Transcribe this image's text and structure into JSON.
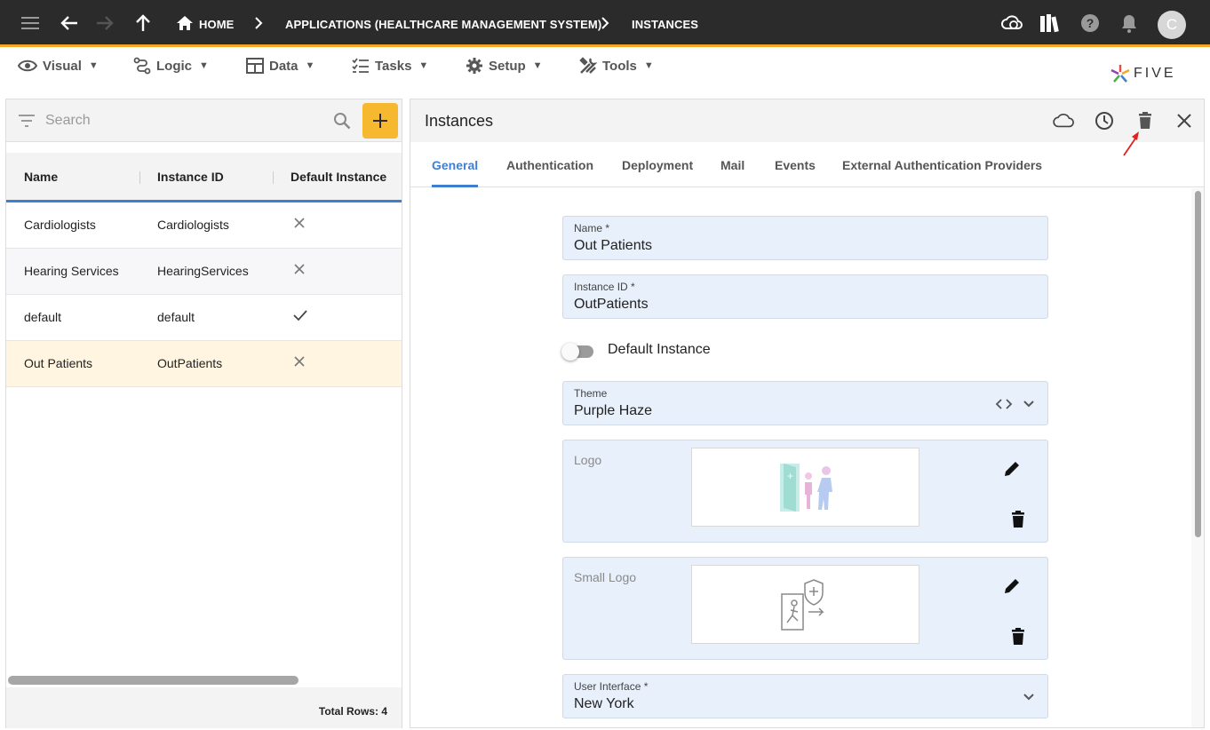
{
  "appbar": {
    "breadcrumbs": [
      {
        "label": "HOME"
      },
      {
        "label": "APPLICATIONS (HEALTHCARE MANAGEMENT SYSTEM)"
      },
      {
        "label": "INSTANCES"
      }
    ],
    "avatar_initial": "C"
  },
  "menu": {
    "items": [
      {
        "label": "Visual",
        "icon": "eye-icon"
      },
      {
        "label": "Logic",
        "icon": "logic-icon"
      },
      {
        "label": "Data",
        "icon": "table-icon"
      },
      {
        "label": "Tasks",
        "icon": "tasks-icon"
      },
      {
        "label": "Setup",
        "icon": "gear-icon"
      },
      {
        "label": "Tools",
        "icon": "tools-icon"
      }
    ],
    "caret": "▼",
    "brand": "FIVE"
  },
  "left": {
    "search_placeholder": "Search",
    "add_label": "+",
    "columns": [
      "Name",
      "Instance ID",
      "Default Instance"
    ],
    "rows": [
      {
        "name": "Cardiologists",
        "instance_id": "Cardiologists",
        "default": false
      },
      {
        "name": "Hearing Services",
        "instance_id": "HearingServices",
        "default": false
      },
      {
        "name": "default",
        "instance_id": "default",
        "default": true
      },
      {
        "name": "Out Patients",
        "instance_id": "OutPatients",
        "default": false,
        "selected": true
      }
    ],
    "total_rows": "Total Rows: 4"
  },
  "detail": {
    "title": "Instances",
    "tabs": [
      "General",
      "Authentication",
      "Deployment",
      "Mail",
      "Events",
      "External Authentication Providers"
    ],
    "active_tab": "General",
    "fields": {
      "name": {
        "label": "Name *",
        "value": "Out Patients"
      },
      "instance_id": {
        "label": "Instance ID *",
        "value": "OutPatients"
      },
      "default_instance": {
        "label": "Default Instance",
        "value": false
      },
      "theme": {
        "label": "Theme",
        "value": "Purple Haze"
      },
      "logo": {
        "label": "Logo"
      },
      "small_logo": {
        "label": "Small Logo"
      },
      "user_interface": {
        "label": "User Interface *",
        "value": "New York"
      }
    }
  },
  "colors": {
    "accent": "#3f7fd0",
    "appbar": "#2b2b2b",
    "appbar_border": "#f5a623",
    "add_button": "#f5b82e",
    "field_bg": "#e7f0fb",
    "selected_row": "#fff5e1",
    "annotation_arrow": "#e02020"
  }
}
